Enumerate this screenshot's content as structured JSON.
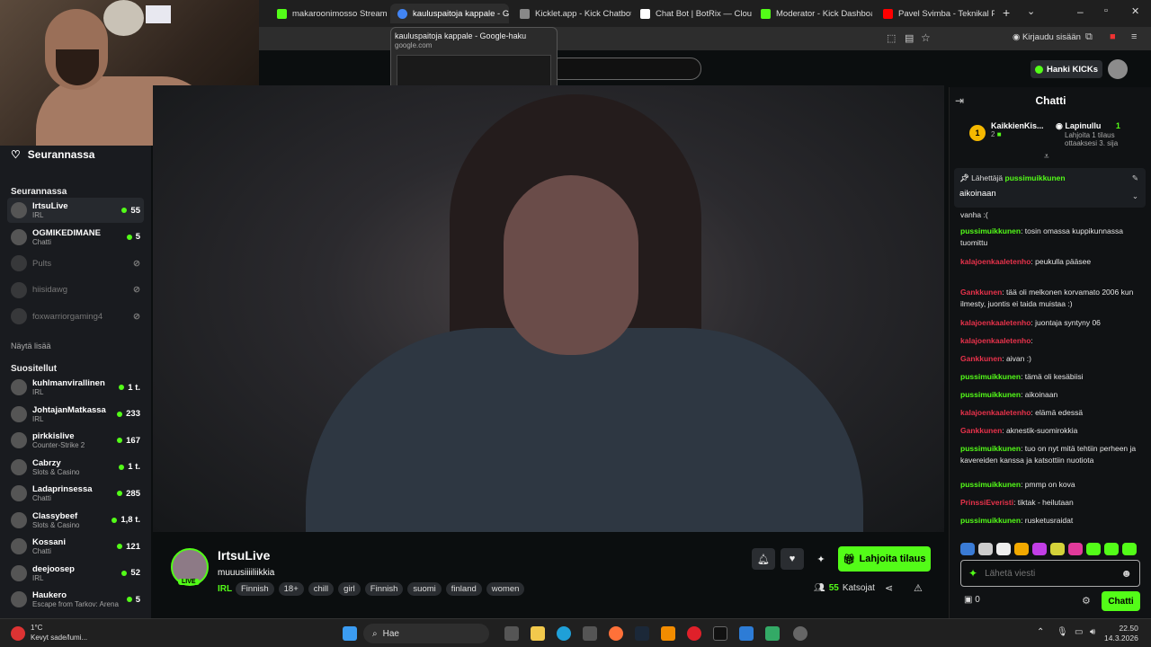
{
  "browser": {
    "tabs": [
      {
        "label": "makaroonimosso Stream -",
        "color": "#53fc18"
      },
      {
        "label": "kauluspaitoja kappale - Go",
        "color": "#4285f4"
      },
      {
        "label": "Kicklet.app - Kick Chatbot",
        "color": "#888888"
      },
      {
        "label": "Chat Bot | BotRix — Cloud",
        "color": "#ffffff"
      },
      {
        "label": "Moderator - Kick Dashboar",
        "color": "#53fc18"
      },
      {
        "label": "Pavel Svimba - Teknikal Pro",
        "color": "#ff0000"
      }
    ],
    "signin": "Kirjaudu sisään",
    "preview": {
      "title": "kauluspaitoja kappale - Google-haku",
      "domain": "google.com"
    }
  },
  "header": {
    "hanki": "Hanki KICKs"
  },
  "sidebar": {
    "title": "Seurannassa",
    "following_label": "Seurannassa",
    "following": [
      {
        "name": "IrtsuLive",
        "cat": "IRL",
        "viewers": "55",
        "selected": true
      },
      {
        "name": "OGMIKEDIMANE",
        "cat": "Chatti",
        "viewers": "5"
      },
      {
        "name": "Pults",
        "off": true
      },
      {
        "name": "hiisidawg",
        "off": true
      },
      {
        "name": "foxwarriorgaming4",
        "off": true
      }
    ],
    "show_more": "Näytä lisää",
    "recommended_label": "Suositellut",
    "recommended": [
      {
        "name": "kuhlmanvirallinen",
        "cat": "IRL",
        "viewers": "1 t."
      },
      {
        "name": "JohtajanMatkassa",
        "cat": "IRL",
        "viewers": "233"
      },
      {
        "name": "pirkkislive",
        "cat": "Counter-Strike 2",
        "viewers": "167"
      },
      {
        "name": "Cabrzy",
        "cat": "Slots & Casino",
        "viewers": "1 t."
      },
      {
        "name": "Ladaprinsessa",
        "cat": "Chatti",
        "viewers": "285"
      },
      {
        "name": "Classybeef",
        "cat": "Slots & Casino",
        "viewers": "1,8 t."
      },
      {
        "name": "Kossani",
        "cat": "Chatti",
        "viewers": "121"
      },
      {
        "name": "deejoosep",
        "cat": "IRL",
        "viewers": "52"
      },
      {
        "name": "Haukero",
        "cat": "Escape from Tarkov: Arena",
        "viewers": "5"
      }
    ]
  },
  "stream": {
    "name": "IrtsuLive",
    "title": "muuusiiiiliikkia",
    "live": "LIVE",
    "category": "IRL",
    "tags": [
      "Finnish",
      "18+",
      "chill",
      "girl",
      "Finnish",
      "suomi",
      "finland",
      "women"
    ],
    "subscribe": "Lahjoita tilaus",
    "viewers": "55",
    "viewers_label": "Katsojat"
  },
  "chat": {
    "title": "Chatti",
    "gifter1": {
      "name": "KaikkienKis...",
      "count": "2",
      "rank": "1"
    },
    "gifter2": {
      "name": "Lapinullu",
      "count": "1",
      "sub": "Lahjoita 1 tilaus ottaaksesi 3. sija"
    },
    "pinned_by_label": "Lähettäjä",
    "pinned_by": "pussimuikkunen",
    "pinned_msg": "aikoinaan",
    "partial": "vanha :(",
    "messages": [
      {
        "user": "pussimuikkunen",
        "text": ": tosin omassa kuppikunnassa tuomittu",
        "color": "#53fc18"
      },
      {
        "user": "kalajoenkaaletenho",
        "text": ": peukulla pääsee",
        "color": "#e8324b"
      },
      {
        "user": "Gankkunen",
        "text": ": tää oli melkonen korvamato 2006 kun ilmesty, juontis ei taida muistaa :)",
        "color": "#e8324b"
      },
      {
        "user": "kalajoenkaaletenho",
        "text": ": juontaja syntyny 06",
        "color": "#e8324b"
      },
      {
        "user": "kalajoenkaaletenho",
        "text": ":",
        "color": "#e8324b"
      },
      {
        "user": "Gankkunen",
        "text": ": aivan :)",
        "color": "#e8324b"
      },
      {
        "user": "pussimuikkunen",
        "text": ": tämä oli kesäbiisi",
        "color": "#53fc18"
      },
      {
        "user": "pussimuikkunen",
        "text": ": aikoinaan",
        "color": "#53fc18"
      },
      {
        "user": "kalajoenkaaletenho",
        "text": ": elämä edessä",
        "color": "#e8324b"
      },
      {
        "user": "Gankkunen",
        "text": ": aknestik-suomirokkia",
        "color": "#e8324b"
      },
      {
        "user": "pussimuikkunen",
        "text": ": tuo on nyt mitä tehtiin perheen ja kavereiden kanssa ja katsottiin nuotiota",
        "color": "#53fc18"
      },
      {
        "user": "pussimuikkunen",
        "text": ": pmmp on kova",
        "color": "#53fc18"
      },
      {
        "user": "PrinssiEveristi",
        "text": ": tiktak - heilutaan",
        "color": "#e8324b"
      },
      {
        "user": "pussimuikkunen",
        "text": ": rusketusraidat",
        "color": "#53fc18"
      }
    ],
    "input_placeholder": "Lähetä viesti",
    "send": "Chatti",
    "points": "0"
  },
  "taskbar": {
    "temp": "1°C",
    "weather": "Kevyt sade/lumi...",
    "search": "Hae",
    "time": "22.50",
    "date": "14.3.2026"
  }
}
